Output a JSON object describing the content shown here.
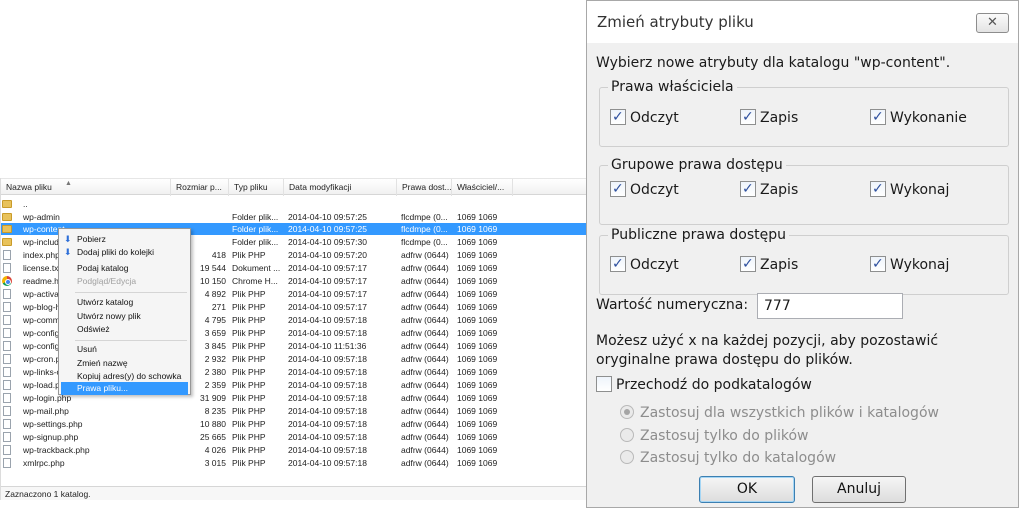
{
  "filelist": {
    "columns": {
      "name": "Nazwa pliku",
      "size": "Rozmiar p...",
      "type": "Typ pliku",
      "date": "Data modyfikacji",
      "perm": "Prawa dost...",
      "owner": "Właściciel/..."
    },
    "rows": [
      {
        "name": "..",
        "size": "",
        "type": "",
        "date": "",
        "perm": "",
        "owner": "",
        "icon": "folder-icon"
      },
      {
        "name": "wp-admin",
        "size": "",
        "type": "Folder plik...",
        "date": "2014-04-10 09:57:25",
        "perm": "flcdmpe (0...",
        "owner": "1069 1069",
        "icon": "folder-icon"
      },
      {
        "name": "wp-content",
        "size": "",
        "type": "Folder plik...",
        "date": "2014-04-10 09:57:25",
        "perm": "flcdmpe (0...",
        "owner": "1069 1069",
        "icon": "folder-icon"
      },
      {
        "name": "wp-includes",
        "size": "",
        "type": "Folder plik...",
        "date": "2014-04-10 09:57:30",
        "perm": "flcdmpe (0...",
        "owner": "1069 1069",
        "icon": "folder-icon"
      },
      {
        "name": "index.php",
        "size": "418",
        "type": "Plik PHP",
        "date": "2014-04-10 09:57:20",
        "perm": "adfrw (0644)",
        "owner": "1069 1069",
        "icon": "file-icon"
      },
      {
        "name": "license.txt",
        "size": "19 544",
        "type": "Dokument ...",
        "date": "2014-04-10 09:57:17",
        "perm": "adfrw (0644)",
        "owner": "1069 1069",
        "icon": "file-icon"
      },
      {
        "name": "readme.html",
        "size": "10 150",
        "type": "Chrome H...",
        "date": "2014-04-10 09:57:17",
        "perm": "adfrw (0644)",
        "owner": "1069 1069",
        "icon": "chrome-icon"
      },
      {
        "name": "wp-activate.php",
        "size": "4 892",
        "type": "Plik PHP",
        "date": "2014-04-10 09:57:17",
        "perm": "adfrw (0644)",
        "owner": "1069 1069",
        "icon": "file-icon"
      },
      {
        "name": "wp-blog-header.php",
        "size": "271",
        "type": "Plik PHP",
        "date": "2014-04-10 09:57:17",
        "perm": "adfrw (0644)",
        "owner": "1069 1069",
        "icon": "file-icon"
      },
      {
        "name": "wp-comments-post.php",
        "size": "4 795",
        "type": "Plik PHP",
        "date": "2014-04-10 09:57:18",
        "perm": "adfrw (0644)",
        "owner": "1069 1069",
        "icon": "file-icon"
      },
      {
        "name": "wp-config-sample.php",
        "size": "3 659",
        "type": "Plik PHP",
        "date": "2014-04-10 09:57:18",
        "perm": "adfrw (0644)",
        "owner": "1069 1069",
        "icon": "file-icon"
      },
      {
        "name": "wp-config.php",
        "size": "3 845",
        "type": "Plik PHP",
        "date": "2014-04-10 11:51:36",
        "perm": "adfrw (0644)",
        "owner": "1069 1069",
        "icon": "file-icon"
      },
      {
        "name": "wp-cron.php",
        "size": "2 932",
        "type": "Plik PHP",
        "date": "2014-04-10 09:57:18",
        "perm": "adfrw (0644)",
        "owner": "1069 1069",
        "icon": "file-icon"
      },
      {
        "name": "wp-links-opml.php",
        "size": "2 380",
        "type": "Plik PHP",
        "date": "2014-04-10 09:57:18",
        "perm": "adfrw (0644)",
        "owner": "1069 1069",
        "icon": "file-icon"
      },
      {
        "name": "wp-load.php",
        "size": "2 359",
        "type": "Plik PHP",
        "date": "2014-04-10 09:57:18",
        "perm": "adfrw (0644)",
        "owner": "1069 1069",
        "icon": "file-icon"
      },
      {
        "name": "wp-login.php",
        "size": "31 909",
        "type": "Plik PHP",
        "date": "2014-04-10 09:57:18",
        "perm": "adfrw (0644)",
        "owner": "1069 1069",
        "icon": "file-icon"
      },
      {
        "name": "wp-mail.php",
        "size": "8 235",
        "type": "Plik PHP",
        "date": "2014-04-10 09:57:18",
        "perm": "adfrw (0644)",
        "owner": "1069 1069",
        "icon": "file-icon"
      },
      {
        "name": "wp-settings.php",
        "size": "10 880",
        "type": "Plik PHP",
        "date": "2014-04-10 09:57:18",
        "perm": "adfrw (0644)",
        "owner": "1069 1069",
        "icon": "file-icon"
      },
      {
        "name": "wp-signup.php",
        "size": "25 665",
        "type": "Plik PHP",
        "date": "2014-04-10 09:57:18",
        "perm": "adfrw (0644)",
        "owner": "1069 1069",
        "icon": "file-icon"
      },
      {
        "name": "wp-trackback.php",
        "size": "4 026",
        "type": "Plik PHP",
        "date": "2014-04-10 09:57:18",
        "perm": "adfrw (0644)",
        "owner": "1069 1069",
        "icon": "file-icon"
      },
      {
        "name": "xmlrpc.php",
        "size": "3 015",
        "type": "Plik PHP",
        "date": "2014-04-10 09:57:18",
        "perm": "adfrw (0644)",
        "owner": "1069 1069",
        "icon": "file-icon"
      }
    ],
    "selected_row": "wp-content",
    "status": "Zaznaczono 1 katalog."
  },
  "context_menu": {
    "items": [
      {
        "label": "Pobierz",
        "icon": "download-icon"
      },
      {
        "label": "Dodaj pliki do kolejki",
        "icon": "add-queue-icon"
      },
      {
        "label": "Podaj katalog"
      },
      {
        "label": "Podgląd/Edycja",
        "disabled": true
      },
      {
        "label": "Utwórz katalog"
      },
      {
        "label": "Utwórz nowy plik"
      },
      {
        "label": "Odśwież"
      },
      {
        "label": "Usuń"
      },
      {
        "label": "Zmień nazwę"
      },
      {
        "label": "Kopiuj adres(y) do schowka"
      },
      {
        "label": "Prawa pliku...",
        "highlighted": true
      }
    ]
  },
  "dialog": {
    "title": "Zmień atrybuty pliku",
    "close_label": "✕",
    "prompt": "Wybierz nowe atrybuty dla katalogu \"wp-content\".",
    "groups": [
      {
        "title": "Prawa właściciela",
        "checks": [
          {
            "label": "Odczyt",
            "checked": true
          },
          {
            "label": "Zapis",
            "checked": true
          },
          {
            "label": "Wykonanie",
            "checked": true
          }
        ]
      },
      {
        "title": "Grupowe prawa dostępu",
        "checks": [
          {
            "label": "Odczyt",
            "checked": true
          },
          {
            "label": "Zapis",
            "checked": true
          },
          {
            "label": "Wykonaj",
            "checked": true
          }
        ]
      },
      {
        "title": "Publiczne prawa dostępu",
        "checks": [
          {
            "label": "Odczyt",
            "checked": true
          },
          {
            "label": "Zapis",
            "checked": true
          },
          {
            "label": "Wykonaj",
            "checked": true
          }
        ]
      }
    ],
    "numeric_label": "Wartość numeryczna:",
    "numeric_value": "777",
    "hint": "Możesz użyć x na każdej pozycji, aby pozostawić oryginalne prawa dostępu do plików.",
    "recurse_label": "Przechodź do podkatalogów",
    "recurse_checked": false,
    "radios": [
      {
        "label": "Zastosuj dla wszystkich plików i katalogów",
        "selected": true
      },
      {
        "label": "Zastosuj tylko do plików",
        "selected": false
      },
      {
        "label": "Zastosuj tylko do katalogów",
        "selected": false
      }
    ],
    "ok_label": "OK",
    "cancel_label": "Anuluj"
  },
  "colors": {
    "selection": "#3399ff",
    "dialog_bg": "#f0f0f0",
    "folder": "#e8c25b"
  }
}
